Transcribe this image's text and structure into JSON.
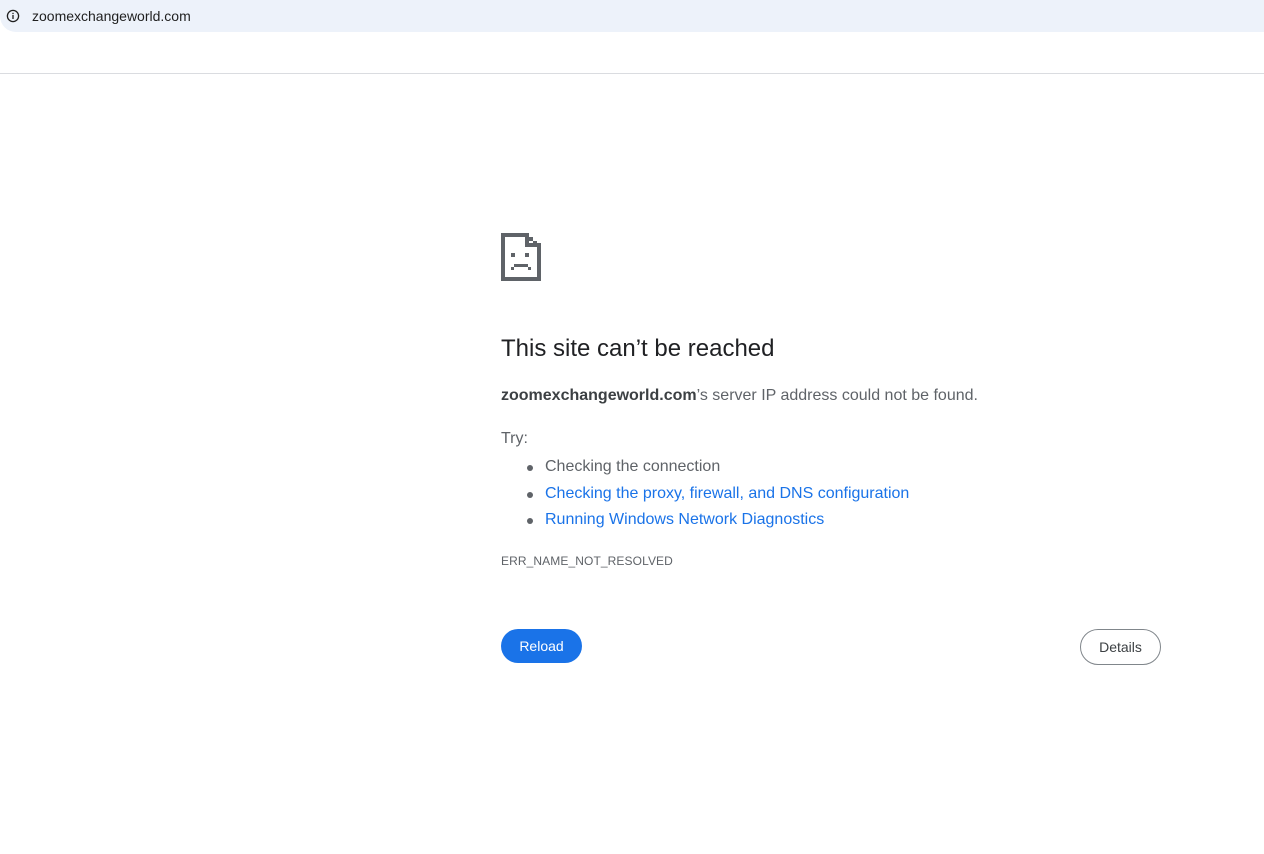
{
  "address_bar": {
    "url": "zoomexchangeworld.com",
    "info_icon": "info-icon"
  },
  "error": {
    "icon": "sad-page-icon",
    "heading": "This site can’t be reached",
    "host": "zoomexchangeworld.com",
    "message_suffix": "’s server IP address could not be found.",
    "try_label": "Try:",
    "suggestions": [
      {
        "text": "Checking the connection",
        "link": false
      },
      {
        "text": "Checking the proxy, firewall, and DNS configuration",
        "link": true
      },
      {
        "text": "Running Windows Network Diagnostics",
        "link": true
      }
    ],
    "code": "ERR_NAME_NOT_RESOLVED"
  },
  "buttons": {
    "reload_label": "Reload",
    "details_label": "Details"
  },
  "colors": {
    "accent": "#1a73e8",
    "text_secondary": "#5f6368",
    "address_bar_bg": "#edf2fa"
  }
}
